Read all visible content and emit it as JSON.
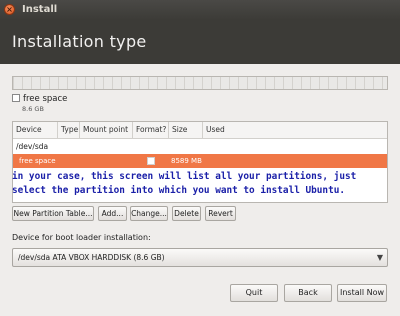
{
  "window": {
    "title": "Install",
    "close_glyph": "×"
  },
  "header": {
    "title": "Installation type"
  },
  "partition_bar": {
    "legend": {
      "label": "free space",
      "size": "8.6 GB"
    }
  },
  "table": {
    "columns": [
      "Device",
      "Type",
      "Mount point",
      "Format?",
      "Size",
      "Used"
    ],
    "device_row": "/dev/sda",
    "selected_row": {
      "device": "free space",
      "size": "8589 MB"
    }
  },
  "annotation": {
    "line1": "in your case, this screen will list all your partitions, just",
    "line2": "select the partition into which you want to install Ubuntu."
  },
  "buttons": {
    "new_partition_table": "New Partition Table...",
    "add": "Add...",
    "change": "Change...",
    "delete": "Delete",
    "revert": "Revert"
  },
  "boot_loader": {
    "label": "Device for boot loader installation:",
    "selected": "/dev/sda  ATA VBOX HARDDISK (8.6 GB)",
    "arrow_glyph": "▼"
  },
  "footer": {
    "quit": "Quit",
    "back": "Back",
    "install_now": "Install Now"
  },
  "colors": {
    "header_bg": "#3c3b37",
    "selection": "#f07746",
    "annotation_text": "#1a1fa8"
  }
}
